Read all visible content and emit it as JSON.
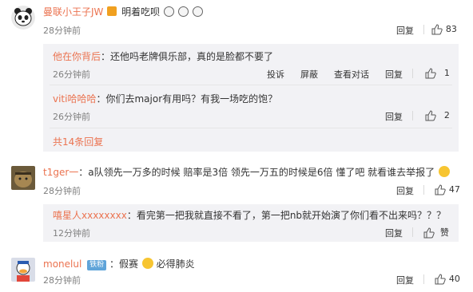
{
  "comments": [
    {
      "user": "曼联小王子JW",
      "text": "明着吃呗",
      "time": "28分钟前",
      "reply_label": "回复",
      "likes": "83"
    },
    {
      "user": "t1ger一",
      "text": "a队领先一万多的时候 赔率是3倍 领先一万五的时候是6倍 懂了吧 就看谁去举报了",
      "time": "28分钟前",
      "reply_label": "回复",
      "likes": "47"
    },
    {
      "user": "monelul",
      "badge": "铁粉",
      "text": "假赛",
      "text2": "必得肺炎",
      "time": "28分钟前",
      "reply_label": "回复",
      "likes": "40"
    }
  ],
  "replies": [
    {
      "user": "他在你背后",
      "text": "：还他吗老牌俱乐部，真的是脸都不要了",
      "time": "26分钟前",
      "actions": [
        "投诉",
        "屏蔽",
        "查看对话",
        "回复"
      ],
      "likes": "1"
    },
    {
      "user": "viti哈哈哈",
      "text": "：你们去major有用吗？有我一场吃的饱？",
      "time": "26分钟前",
      "reply_label": "回复",
      "likes": "2"
    },
    {
      "user": "嘻星人xxxxxxxx",
      "text": "：看完第一把我就直接不看了，第一把nb就开始演了你们看不出来吗？？？",
      "time": "12分钟前",
      "reply_label": "回复",
      "likes": "赞"
    }
  ],
  "more_replies": "共14条回复",
  "colors": {
    "username": "#eb7350",
    "reply_bg": "#f2f2f5",
    "badge": "#5fa4d9"
  }
}
